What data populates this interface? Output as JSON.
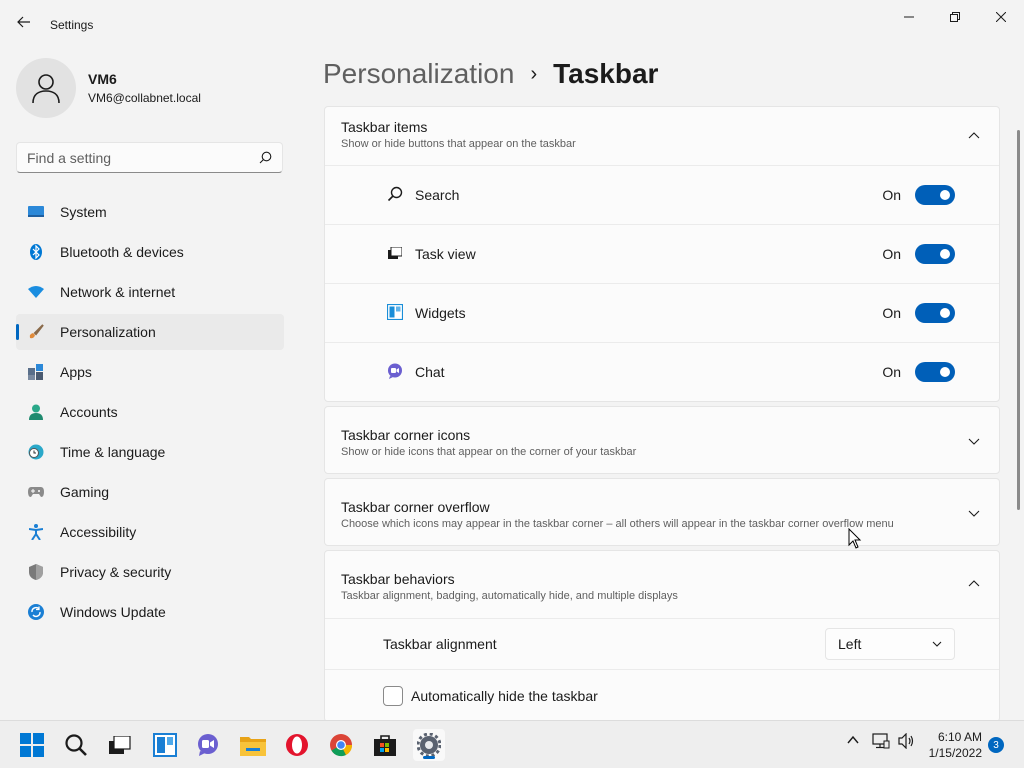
{
  "window": {
    "title": "Settings",
    "controls": [
      "minimize",
      "maximize",
      "close"
    ]
  },
  "profile": {
    "name": "VM6",
    "email": "VM6@collabnet.local"
  },
  "search": {
    "placeholder": "Find a setting"
  },
  "sidebar": {
    "items": [
      {
        "label": "System",
        "icon": "system-icon",
        "active": false
      },
      {
        "label": "Bluetooth & devices",
        "icon": "bluetooth-icon",
        "active": false
      },
      {
        "label": "Network & internet",
        "icon": "wifi-icon",
        "active": false
      },
      {
        "label": "Personalization",
        "icon": "brush-icon",
        "active": true
      },
      {
        "label": "Apps",
        "icon": "apps-icon",
        "active": false
      },
      {
        "label": "Accounts",
        "icon": "accounts-icon",
        "active": false
      },
      {
        "label": "Time & language",
        "icon": "clock-globe-icon",
        "active": false
      },
      {
        "label": "Gaming",
        "icon": "gamepad-icon",
        "active": false
      },
      {
        "label": "Accessibility",
        "icon": "accessibility-icon",
        "active": false
      },
      {
        "label": "Privacy & security",
        "icon": "shield-icon",
        "active": false
      },
      {
        "label": "Windows Update",
        "icon": "update-icon",
        "active": false
      }
    ]
  },
  "breadcrumb": {
    "parent": "Personalization",
    "separator": "›",
    "current": "Taskbar"
  },
  "sections": {
    "taskbar_items": {
      "title": "Taskbar items",
      "subtitle": "Show or hide buttons that appear on the taskbar",
      "expanded": true,
      "rows": [
        {
          "label": "Search",
          "state": "On",
          "icon": "search-icon"
        },
        {
          "label": "Task view",
          "state": "On",
          "icon": "task-view-icon"
        },
        {
          "label": "Widgets",
          "state": "On",
          "icon": "widgets-icon"
        },
        {
          "label": "Chat",
          "state": "On",
          "icon": "chat-icon"
        }
      ]
    },
    "corner_icons": {
      "title": "Taskbar corner icons",
      "subtitle": "Show or hide icons that appear on the corner of your taskbar",
      "expanded": false
    },
    "corner_overflow": {
      "title": "Taskbar corner overflow",
      "subtitle": "Choose which icons may appear in the taskbar corner – all others will appear in the taskbar corner overflow menu",
      "expanded": false
    },
    "behaviors": {
      "title": "Taskbar behaviors",
      "subtitle": "Taskbar alignment, badging, automatically hide, and multiple displays",
      "expanded": true,
      "alignment_label": "Taskbar alignment",
      "alignment_value": "Left",
      "autohide_label": "Automatically hide the taskbar"
    }
  },
  "taskbar": {
    "apps": [
      "start-icon",
      "search-icon",
      "task-view-icon",
      "widgets-icon",
      "chat-icon",
      "file-explorer-icon",
      "opera-icon",
      "chrome-icon",
      "store-icon",
      "settings-icon"
    ],
    "time": "6:10 AM",
    "date": "1/15/2022",
    "notification_count": "3"
  },
  "colors": {
    "accent": "#0067c0",
    "toggle_on": "#005fb8",
    "background": "#f3f3f3",
    "card": "#fbfbfb"
  }
}
